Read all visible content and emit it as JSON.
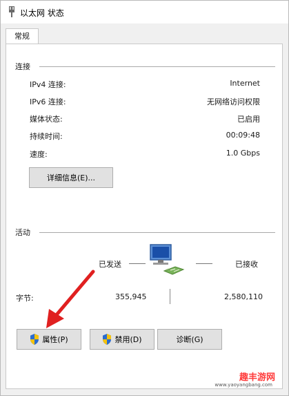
{
  "window": {
    "title": "以太网 状态"
  },
  "tabs": [
    {
      "label": "常规"
    }
  ],
  "connection": {
    "section_label": "连接",
    "rows": [
      {
        "label": "IPv4 连接:",
        "value": "Internet"
      },
      {
        "label": "IPv6 连接:",
        "value": "无网络访问权限"
      },
      {
        "label": "媒体状态:",
        "value": "已启用"
      },
      {
        "label": "持续时间:",
        "value": "00:09:48"
      },
      {
        "label": "速度:",
        "value": "1.0 Gbps"
      }
    ],
    "details_button": "详细信息(E)..."
  },
  "activity": {
    "section_label": "活动",
    "sent_label": "已发送",
    "received_label": "已接收",
    "bytes_label": "字节:",
    "bytes_sent": "355,945",
    "bytes_received": "2,580,110"
  },
  "buttons": {
    "properties": "属性(P)",
    "disable": "禁用(D)",
    "diagnose": "诊断(G)"
  },
  "icons": {
    "title": "network-adapter-icon",
    "network": "network-computer-icon",
    "shield": "uac-shield-icon",
    "arrow": "red-arrow-annotation"
  },
  "colors": {
    "arrow": "#e02020",
    "shield_blue": "#2a6ccf",
    "shield_yellow": "#f4c20d"
  },
  "watermark": {
    "text": "趣丰游网",
    "url": "www.yaoyangbang.com"
  }
}
